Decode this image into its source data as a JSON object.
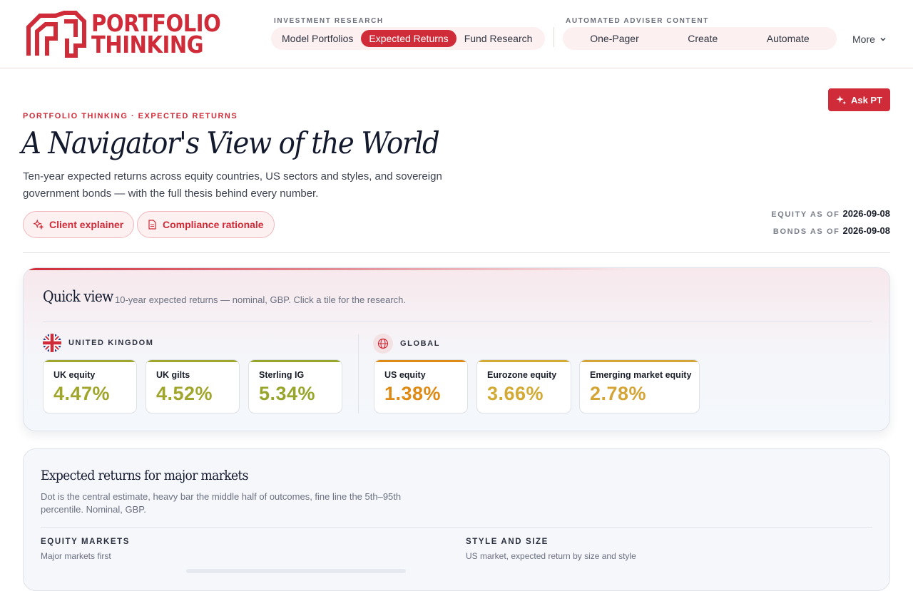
{
  "brand": {
    "line1": "PORTFOLIO",
    "line2": "THINKING",
    "color": "#cf2b38"
  },
  "nav": {
    "research_label": "INVESTMENT RESEARCH",
    "research_items": [
      "Model Portfolios",
      "Expected Returns",
      "Fund Research"
    ],
    "active_item": "Expected Returns",
    "adviser_label": "AUTOMATED ADVISER CONTENT",
    "adviser_items": [
      "One-Pager",
      "Create",
      "Automate"
    ],
    "more_label": "More"
  },
  "ask_button": "Ask PT",
  "page": {
    "eyebrow": "PORTFOLIO THINKING · EXPECTED RETURNS",
    "title": "A Navigator's View of the World",
    "subtitle": "Ten-year expected returns across equity countries, US sectors and styles, and sovereign government bonds — with the full thesis behind every number.",
    "chips": [
      "Client explainer",
      "Compliance rationale"
    ],
    "equity_asof_label": "EQUITY AS OF",
    "equity_asof": "2026-09-08",
    "bonds_asof_label": "BONDS AS OF",
    "bonds_asof": "2026-09-08"
  },
  "quick_view": {
    "title": "Quick view",
    "subtitle": "10-year expected returns — nominal, GBP. Click a tile for the research.",
    "uk_label": "UNITED KINGDOM",
    "global_label": "GLOBAL",
    "uk_tiles": [
      {
        "name": "UK equity",
        "value": "4.47%",
        "color": "#a0a62c"
      },
      {
        "name": "UK gilts",
        "value": "4.52%",
        "color": "#a0a62c"
      },
      {
        "name": "Sterling IG",
        "value": "5.34%",
        "color": "#97a52a"
      }
    ],
    "global_tiles": [
      {
        "name": "US equity",
        "value": "1.38%",
        "color": "#de8a14"
      },
      {
        "name": "Eurozone equity",
        "value": "3.66%",
        "color": "#d2aa34"
      },
      {
        "name": "Emerging market equity",
        "value": "2.78%",
        "color": "#d4a536"
      }
    ]
  },
  "expected_returns": {
    "title": "Expected returns for major markets",
    "description": "Dot is the central estimate, heavy bar the middle half of outcomes, fine line the 5th–95th percentile. Nominal, GBP.",
    "equity_heading": "EQUITY MARKETS",
    "equity_sub": "Major markets first",
    "style_heading": "STYLE AND SIZE",
    "style_sub": "US market, expected return by size and style"
  }
}
